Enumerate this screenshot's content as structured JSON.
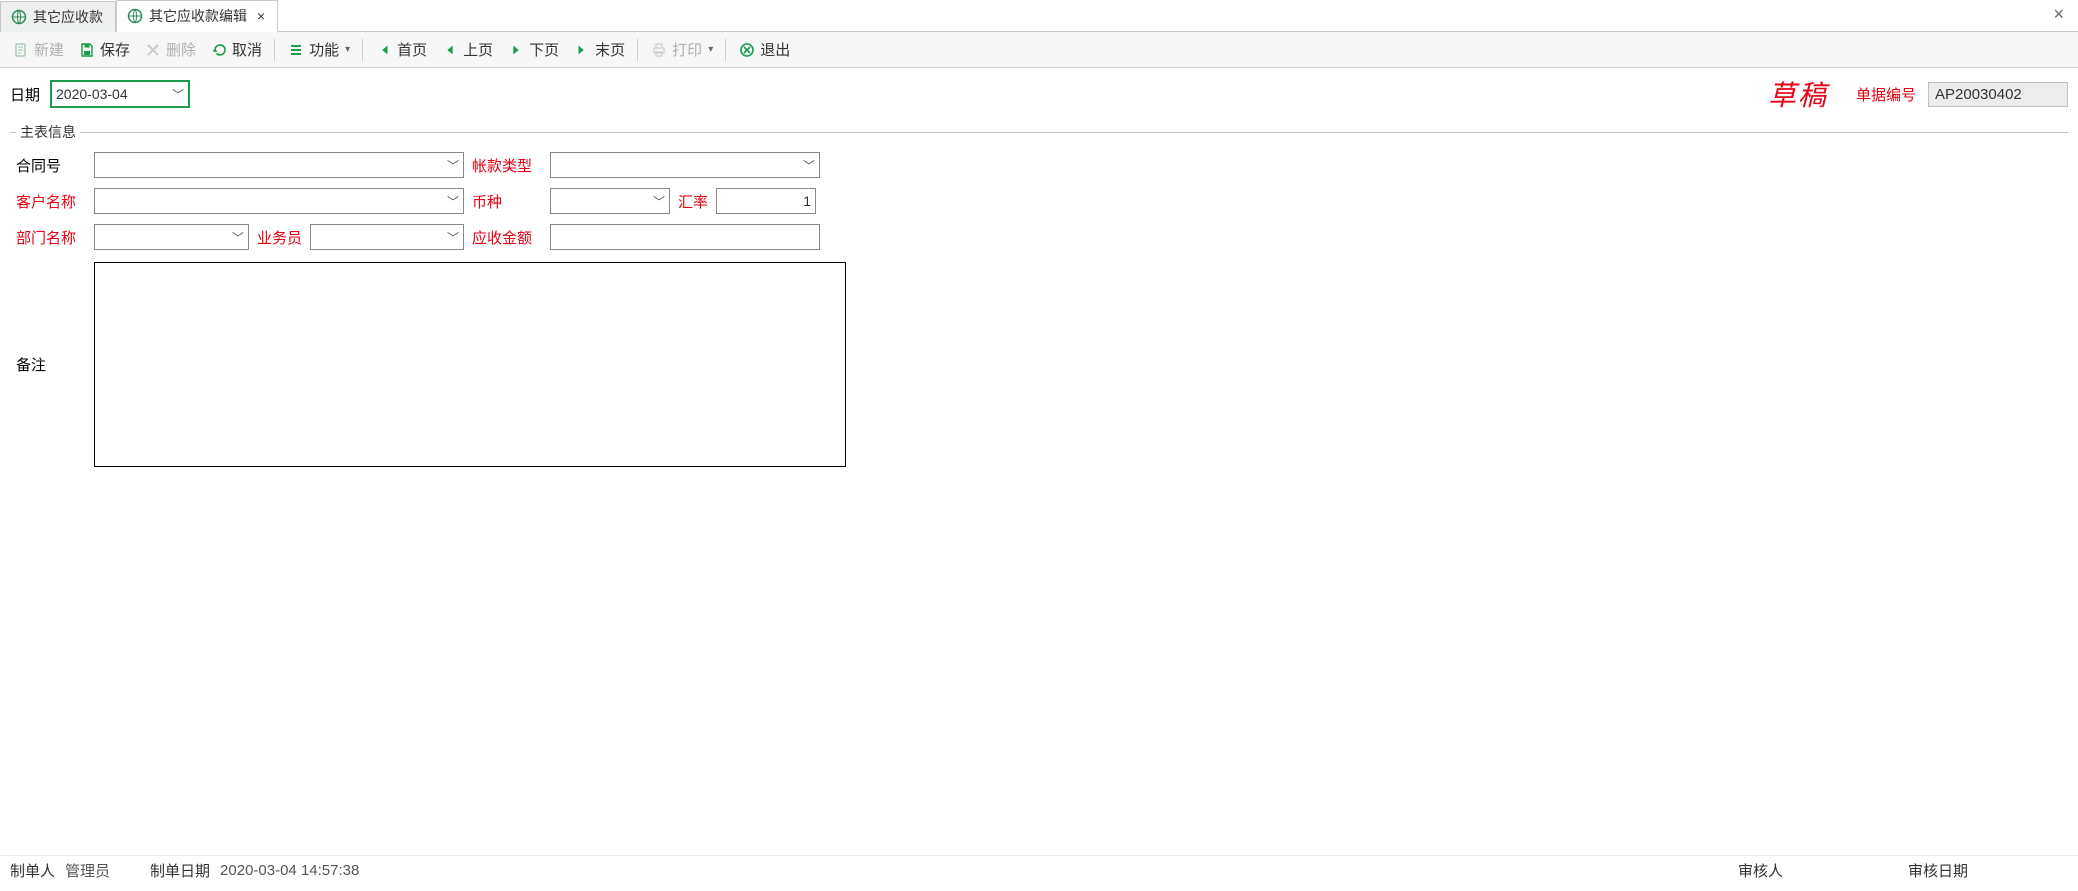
{
  "tabs": [
    {
      "label": "其它应收款",
      "active": false,
      "closable": false
    },
    {
      "label": "其它应收款编辑",
      "active": true,
      "closable": true
    }
  ],
  "toolbar": {
    "new": "新建",
    "save": "保存",
    "delete": "删除",
    "cancel": "取消",
    "function": "功能",
    "first": "首页",
    "prev": "上页",
    "next": "下页",
    "last": "末页",
    "print": "打印",
    "exit": "退出"
  },
  "header": {
    "date_label": "日期",
    "date_value": "2020-03-04",
    "status_text": "草稿",
    "docno_label": "单据编号",
    "docno_value": "AP20030402"
  },
  "form": {
    "legend": "主表信息",
    "contract_label": "合同号",
    "contract_value": "",
    "acct_type_label": "帐款类型",
    "acct_type_value": "",
    "customer_label": "客户名称",
    "customer_value": "",
    "currency_label": "币种",
    "currency_value": "",
    "rate_label": "汇率",
    "rate_value": "1",
    "dept_label": "部门名称",
    "dept_value": "",
    "sales_label": "业务员",
    "sales_value": "",
    "amount_label": "应收金额",
    "amount_value": "",
    "remark_label": "备注",
    "remark_value": ""
  },
  "footer": {
    "maker_label": "制单人",
    "maker_value": "管理员",
    "maker_date_label": "制单日期",
    "maker_date_value": "2020-03-04 14:57:38",
    "auditor_label": "审核人",
    "auditor_value": "",
    "audit_date_label": "审核日期",
    "audit_date_value": ""
  }
}
